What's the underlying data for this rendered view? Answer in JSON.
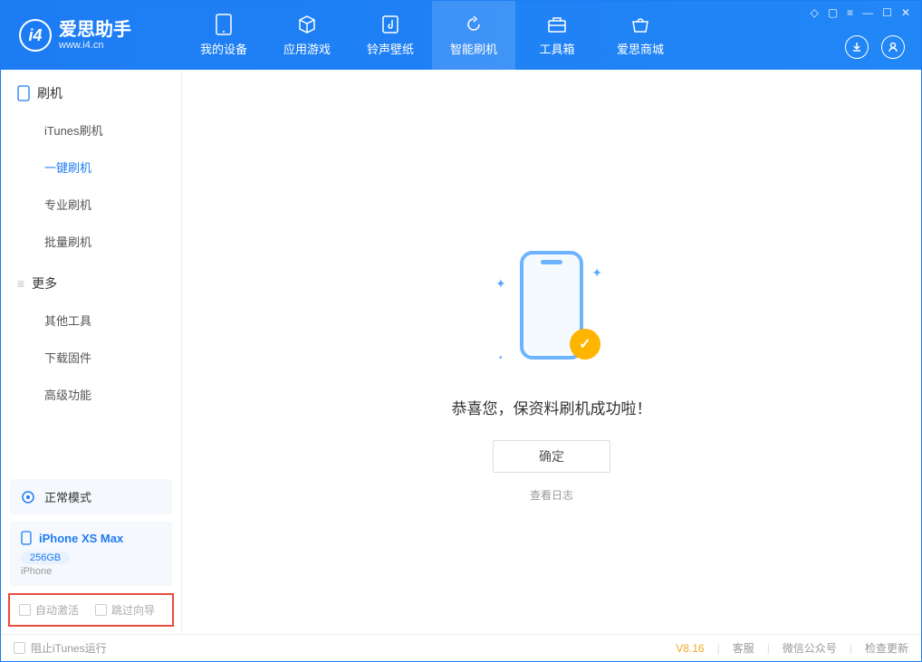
{
  "app": {
    "name": "爱思助手",
    "url": "www.i4.cn"
  },
  "titlebar": {
    "icons": [
      "◇",
      "▢",
      "≡",
      "—",
      "☐",
      "✕"
    ]
  },
  "nav": {
    "tabs": [
      {
        "label": "我的设备",
        "icon": "phone"
      },
      {
        "label": "应用游戏",
        "icon": "cube"
      },
      {
        "label": "铃声壁纸",
        "icon": "music"
      },
      {
        "label": "智能刷机",
        "icon": "refresh",
        "active": true
      },
      {
        "label": "工具箱",
        "icon": "toolbox"
      },
      {
        "label": "爱思商城",
        "icon": "store"
      }
    ]
  },
  "sidebar": {
    "section1": {
      "title": "刷机",
      "items": [
        "iTunes刷机",
        "一键刷机",
        "专业刷机",
        "批量刷机"
      ],
      "activeIndex": 1
    },
    "section2": {
      "title": "更多",
      "items": [
        "其他工具",
        "下载固件",
        "高级功能"
      ]
    },
    "mode": {
      "label": "正常模式"
    },
    "device": {
      "name": "iPhone XS Max",
      "capacity": "256GB",
      "type": "iPhone"
    },
    "checkboxes": {
      "auto_activate": "自动激活",
      "skip_guide": "跳过向导"
    }
  },
  "main": {
    "success_message": "恭喜您，保资料刷机成功啦！",
    "ok_button": "确定",
    "view_log": "查看日志"
  },
  "footer": {
    "block_itunes": "阻止iTunes运行",
    "version": "V8.16",
    "links": [
      "客服",
      "微信公众号",
      "检查更新"
    ]
  }
}
